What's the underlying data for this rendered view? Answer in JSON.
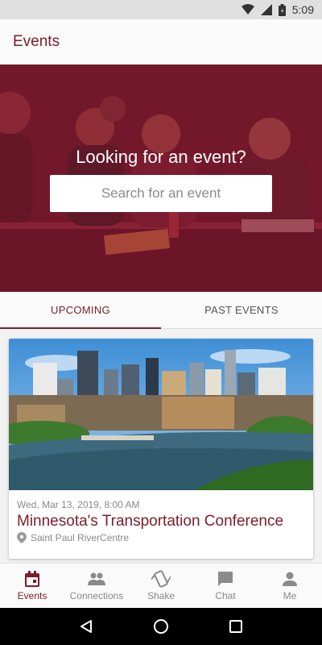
{
  "status_bar": {
    "time": "5:09",
    "icons": [
      "wifi-icon",
      "signal-icon",
      "battery-icon"
    ]
  },
  "app_bar": {
    "title": "Events"
  },
  "hero": {
    "title": "Looking for an event?",
    "search_placeholder": "Search for an event"
  },
  "tabs": [
    {
      "label": "UPCOMING",
      "active": true
    },
    {
      "label": "PAST EVENTS",
      "active": false
    }
  ],
  "events": [
    {
      "date": "Wed, Mar 13, 2019, 8:00 AM",
      "title": "Minnesota's Transportation Conference",
      "location": "Saint Paul RiverCentre",
      "location_icon": "location-pin-icon"
    }
  ],
  "bottom_nav": [
    {
      "label": "Events",
      "icon": "calendar-icon",
      "active": true
    },
    {
      "label": "Connections",
      "icon": "people-icon",
      "active": false
    },
    {
      "label": "Shake",
      "icon": "shake-phone-icon",
      "active": false
    },
    {
      "label": "Chat",
      "icon": "chat-icon",
      "active": false
    },
    {
      "label": "Me",
      "icon": "person-icon",
      "active": false
    }
  ],
  "system_nav": [
    "back-icon",
    "home-icon",
    "recents-icon"
  ],
  "colors": {
    "accent": "#7b1c2b",
    "hero_overlay": "#891830",
    "inactive": "#888888"
  }
}
